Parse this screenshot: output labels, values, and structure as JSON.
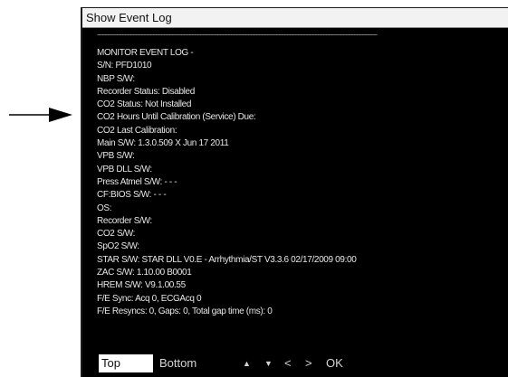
{
  "window": {
    "title": "Show Event Log"
  },
  "log": {
    "separator": "~~~~~~~~~~~~~~~~~~~~~~~~~~~~~~~~~~~~~~~~~~~~~~~~~~~~~~~~~~~~~~~~~~~~~~~~~~~~~~~~~~~~~~~~~~~~~~~~~~~~",
    "lines": [
      "MONITOR EVENT LOG -",
      "S/N: PFD1010",
      "NBP S/W:",
      "Recorder Status: Disabled",
      "CO2 Status: Not Installed",
      "CO2 Hours Until Calibration (Service) Due:",
      "CO2 Last Calibration:",
      "Main S/W: 1.3.0.509 X Jun 17 2011",
      "VPB S/W:",
      "VPB DLL S/W:",
      "Press Atmel S/W: - - -",
      "CF:BIOS S/W: - - -",
      "OS:",
      "Recorder S/W:",
      "CO2 S/W:",
      "SpO2 S/W:",
      "STAR S/W: STAR DLL V0.E - Arrhythmia/ST V3.3.6 02/17/2009 09:00",
      "ZAC S/W: 1.10.00 B0001",
      "HREM S/W: V9.1.00.55",
      "F/E Sync: Acq 0, ECGAcq 0",
      "F/E Resyncs: 0, Gaps: 0, Total gap time (ms): 0"
    ]
  },
  "nav": {
    "top_label": "Top",
    "bottom_label": "Bottom",
    "page_up_glyph": "▲",
    "page_down_glyph": "▼",
    "prev_glyph": "<",
    "next_glyph": ">",
    "ok_label": "OK",
    "selected": "Top"
  },
  "colors": {
    "log_background": "#000000",
    "log_text": "#e6e6e6",
    "selected_button_background": "#ffffff"
  },
  "icons": {
    "pointer": "arrow-right-icon"
  }
}
